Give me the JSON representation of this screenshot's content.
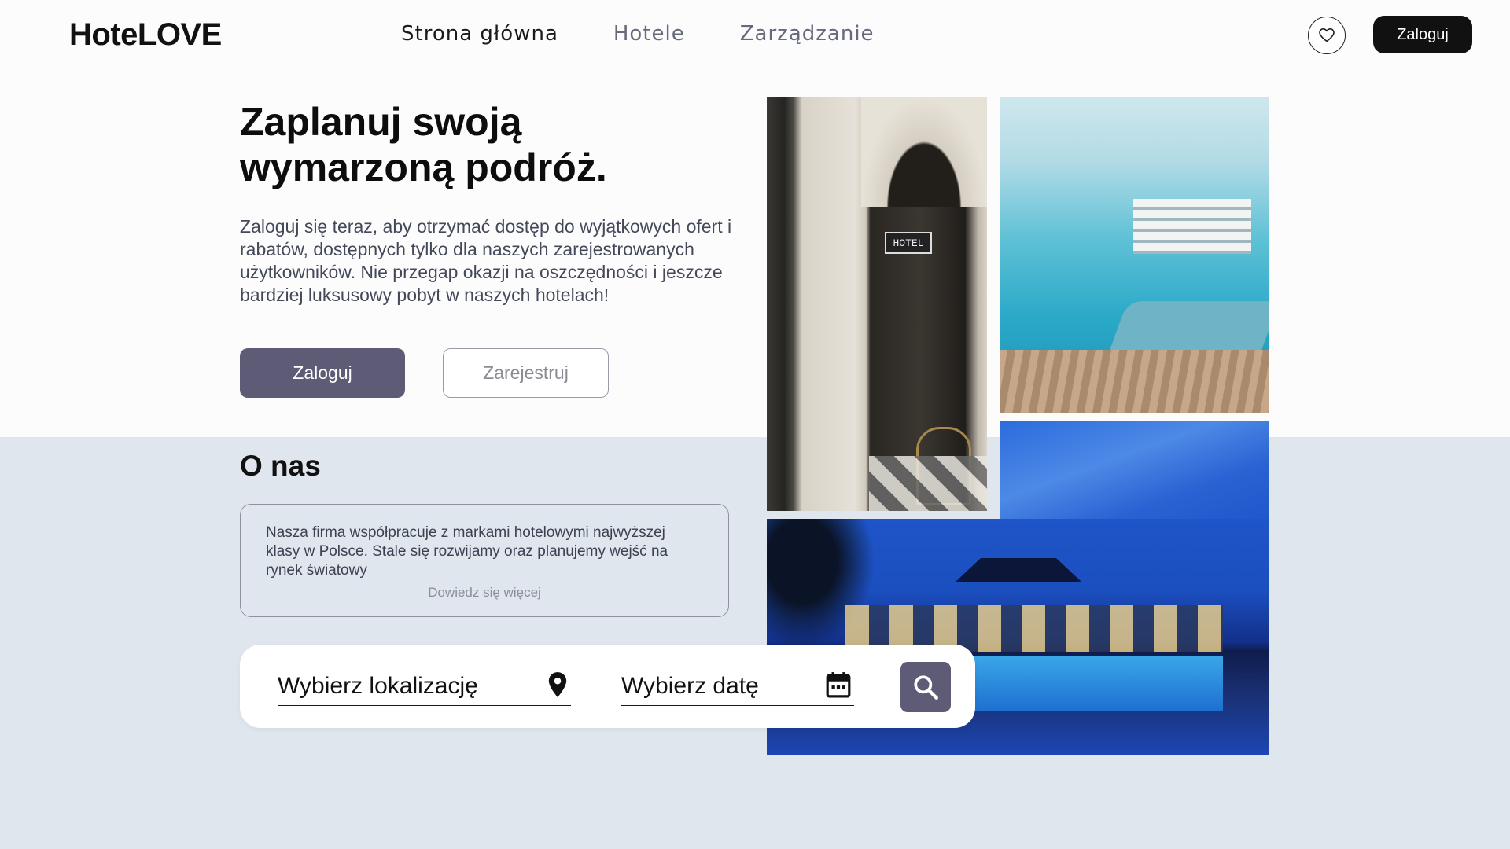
{
  "header": {
    "logo": "HoteLOVE",
    "nav": [
      "Strona główna",
      "Hotele",
      "Zarządzanie"
    ],
    "login_label": "Zaloguj"
  },
  "hero": {
    "title": "Zaplanuj swoją wymarzoną podróż.",
    "text": "Zaloguj się teraz, aby otrzymać dostęp do wyjątkowych ofert i rabatów, dostępnych tylko dla naszych zarejestrowanych użytkowników. Nie przegap okazji na oszczędności i jeszcze bardziej luksusowy pobyt w naszych hotelach!",
    "login_button": "Zaloguj",
    "register_button": "Zarejestruj"
  },
  "about": {
    "title": "O nas",
    "text": "Nasza firma współpracuje z markami hotelowymi najwyższej klasy w Polsce. Stale się rozwijamy oraz planujemy wejść na rynek światowy",
    "more_link": "Dowiedz się więcej"
  },
  "images": {
    "door_sign": "HOTEL"
  },
  "search": {
    "location_label": "Wybierz lokalizację",
    "date_label": "Wybierz datę"
  },
  "colors": {
    "accent": "#5d5b75",
    "header_button": "#111111",
    "lower_background": "#dfe6ee"
  },
  "icons": [
    "heart-icon",
    "location-pin-icon",
    "calendar-icon",
    "search-icon"
  ]
}
